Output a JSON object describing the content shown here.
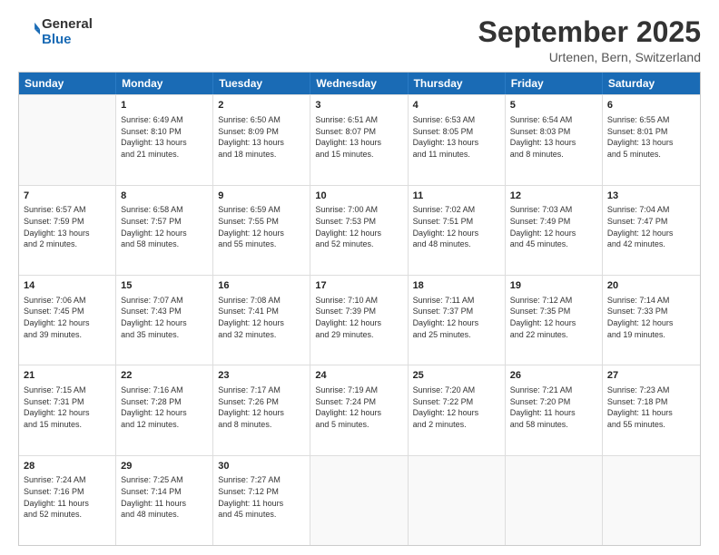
{
  "logo": {
    "line1": "General",
    "line2": "Blue"
  },
  "title": "September 2025",
  "subtitle": "Urtenen, Bern, Switzerland",
  "days": [
    "Sunday",
    "Monday",
    "Tuesday",
    "Wednesday",
    "Thursday",
    "Friday",
    "Saturday"
  ],
  "weeks": [
    [
      {
        "day": "",
        "text": ""
      },
      {
        "day": "1",
        "text": "Sunrise: 6:49 AM\nSunset: 8:10 PM\nDaylight: 13 hours\nand 21 minutes."
      },
      {
        "day": "2",
        "text": "Sunrise: 6:50 AM\nSunset: 8:09 PM\nDaylight: 13 hours\nand 18 minutes."
      },
      {
        "day": "3",
        "text": "Sunrise: 6:51 AM\nSunset: 8:07 PM\nDaylight: 13 hours\nand 15 minutes."
      },
      {
        "day": "4",
        "text": "Sunrise: 6:53 AM\nSunset: 8:05 PM\nDaylight: 13 hours\nand 11 minutes."
      },
      {
        "day": "5",
        "text": "Sunrise: 6:54 AM\nSunset: 8:03 PM\nDaylight: 13 hours\nand 8 minutes."
      },
      {
        "day": "6",
        "text": "Sunrise: 6:55 AM\nSunset: 8:01 PM\nDaylight: 13 hours\nand 5 minutes."
      }
    ],
    [
      {
        "day": "7",
        "text": "Sunrise: 6:57 AM\nSunset: 7:59 PM\nDaylight: 13 hours\nand 2 minutes."
      },
      {
        "day": "8",
        "text": "Sunrise: 6:58 AM\nSunset: 7:57 PM\nDaylight: 12 hours\nand 58 minutes."
      },
      {
        "day": "9",
        "text": "Sunrise: 6:59 AM\nSunset: 7:55 PM\nDaylight: 12 hours\nand 55 minutes."
      },
      {
        "day": "10",
        "text": "Sunrise: 7:00 AM\nSunset: 7:53 PM\nDaylight: 12 hours\nand 52 minutes."
      },
      {
        "day": "11",
        "text": "Sunrise: 7:02 AM\nSunset: 7:51 PM\nDaylight: 12 hours\nand 48 minutes."
      },
      {
        "day": "12",
        "text": "Sunrise: 7:03 AM\nSunset: 7:49 PM\nDaylight: 12 hours\nand 45 minutes."
      },
      {
        "day": "13",
        "text": "Sunrise: 7:04 AM\nSunset: 7:47 PM\nDaylight: 12 hours\nand 42 minutes."
      }
    ],
    [
      {
        "day": "14",
        "text": "Sunrise: 7:06 AM\nSunset: 7:45 PM\nDaylight: 12 hours\nand 39 minutes."
      },
      {
        "day": "15",
        "text": "Sunrise: 7:07 AM\nSunset: 7:43 PM\nDaylight: 12 hours\nand 35 minutes."
      },
      {
        "day": "16",
        "text": "Sunrise: 7:08 AM\nSunset: 7:41 PM\nDaylight: 12 hours\nand 32 minutes."
      },
      {
        "day": "17",
        "text": "Sunrise: 7:10 AM\nSunset: 7:39 PM\nDaylight: 12 hours\nand 29 minutes."
      },
      {
        "day": "18",
        "text": "Sunrise: 7:11 AM\nSunset: 7:37 PM\nDaylight: 12 hours\nand 25 minutes."
      },
      {
        "day": "19",
        "text": "Sunrise: 7:12 AM\nSunset: 7:35 PM\nDaylight: 12 hours\nand 22 minutes."
      },
      {
        "day": "20",
        "text": "Sunrise: 7:14 AM\nSunset: 7:33 PM\nDaylight: 12 hours\nand 19 minutes."
      }
    ],
    [
      {
        "day": "21",
        "text": "Sunrise: 7:15 AM\nSunset: 7:31 PM\nDaylight: 12 hours\nand 15 minutes."
      },
      {
        "day": "22",
        "text": "Sunrise: 7:16 AM\nSunset: 7:28 PM\nDaylight: 12 hours\nand 12 minutes."
      },
      {
        "day": "23",
        "text": "Sunrise: 7:17 AM\nSunset: 7:26 PM\nDaylight: 12 hours\nand 8 minutes."
      },
      {
        "day": "24",
        "text": "Sunrise: 7:19 AM\nSunset: 7:24 PM\nDaylight: 12 hours\nand 5 minutes."
      },
      {
        "day": "25",
        "text": "Sunrise: 7:20 AM\nSunset: 7:22 PM\nDaylight: 12 hours\nand 2 minutes."
      },
      {
        "day": "26",
        "text": "Sunrise: 7:21 AM\nSunset: 7:20 PM\nDaylight: 11 hours\nand 58 minutes."
      },
      {
        "day": "27",
        "text": "Sunrise: 7:23 AM\nSunset: 7:18 PM\nDaylight: 11 hours\nand 55 minutes."
      }
    ],
    [
      {
        "day": "28",
        "text": "Sunrise: 7:24 AM\nSunset: 7:16 PM\nDaylight: 11 hours\nand 52 minutes."
      },
      {
        "day": "29",
        "text": "Sunrise: 7:25 AM\nSunset: 7:14 PM\nDaylight: 11 hours\nand 48 minutes."
      },
      {
        "day": "30",
        "text": "Sunrise: 7:27 AM\nSunset: 7:12 PM\nDaylight: 11 hours\nand 45 minutes."
      },
      {
        "day": "",
        "text": ""
      },
      {
        "day": "",
        "text": ""
      },
      {
        "day": "",
        "text": ""
      },
      {
        "day": "",
        "text": ""
      }
    ]
  ]
}
